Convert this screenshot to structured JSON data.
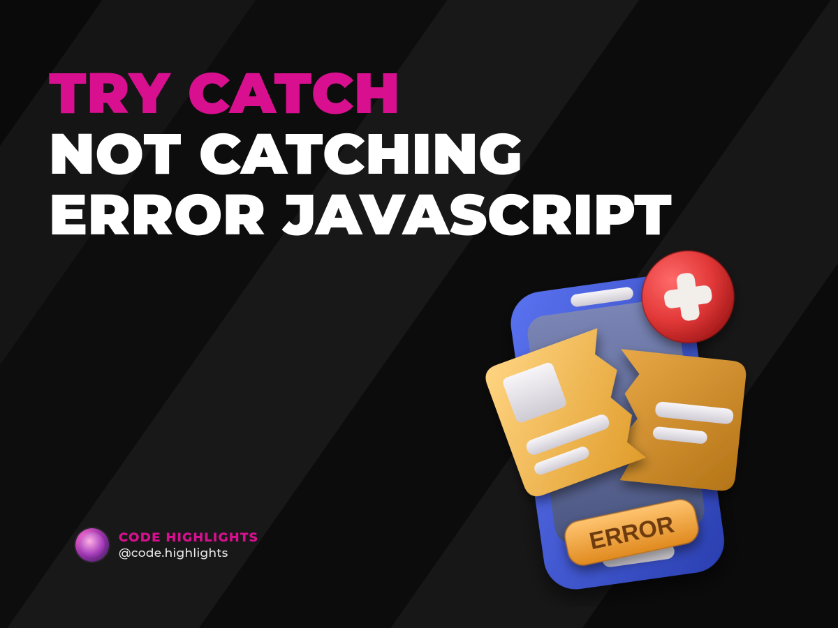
{
  "headline": {
    "line1": "TRY CATCH",
    "line2": "NOT CATCHING",
    "line3": "ERROR JAVASCRIPT"
  },
  "byline": {
    "brand": "CODE HIGHLIGHTS",
    "handle": "@code.highlights"
  },
  "illustration": {
    "badge_label": "ERROR",
    "colors": {
      "accent": "#d8108f",
      "phone_outer": "#3e56d4",
      "phone_inner": "#5f6a99",
      "file_front": "#f0b547",
      "file_back": "#cf8f2e",
      "placeholder": "#e8e6ea",
      "error_red": "#e23838",
      "error_red_dark": "#b51f1f",
      "badge_fill": "#f3a037",
      "badge_text": "#6d3a10"
    }
  }
}
